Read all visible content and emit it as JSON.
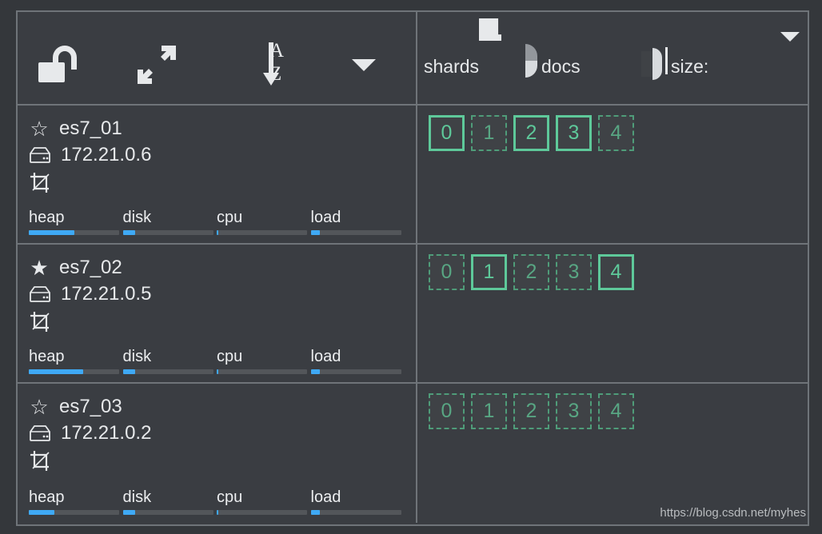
{
  "app": {
    "background_color": "#34373b",
    "panel_color": "#3a3d42",
    "border_color": "#6f7479",
    "accent_green": "#5ec99a",
    "accent_blue": "#3fa9f5",
    "text_color": "#e7e9eb"
  },
  "toolbar": {
    "unlock_icon": "unlock-icon",
    "expand_icon": "expand-arrows-icon",
    "sort_icon": "sort-alpha-down-icon",
    "sort_letters": {
      "first": "A",
      "second": "Z"
    },
    "filter_caret": "caret-down-icon",
    "collapse_caret": "caret-down-icon"
  },
  "summary": {
    "shards_label": "shards",
    "docs_label": "docs",
    "size_label": "size:",
    "shards_icon": "shards-square-icon",
    "docs_icon": "docs-half-circle-icon",
    "size_icon": "size-half-circle-icon"
  },
  "metric_labels": {
    "heap": "heap",
    "disk": "disk",
    "cpu": "cpu",
    "load": "load"
  },
  "nodes": [
    {
      "name": "es7_01",
      "ip": "172.21.0.6",
      "master": false,
      "star_icon": "star-outline-icon",
      "host_icon": "hdd-icon",
      "role_icon": "crop-icon",
      "metrics": {
        "heap": 50,
        "disk": 14,
        "cpu": 2,
        "load": 10
      },
      "shards": [
        {
          "id": "0",
          "type": "primary"
        },
        {
          "id": "1",
          "type": "replica"
        },
        {
          "id": "2",
          "type": "primary"
        },
        {
          "id": "3",
          "type": "primary"
        },
        {
          "id": "4",
          "type": "replica"
        }
      ]
    },
    {
      "name": "es7_02",
      "ip": "172.21.0.5",
      "master": true,
      "star_icon": "star-filled-icon",
      "host_icon": "hdd-icon",
      "role_icon": "crop-icon",
      "metrics": {
        "heap": 60,
        "disk": 14,
        "cpu": 2,
        "load": 10
      },
      "shards": [
        {
          "id": "0",
          "type": "replica"
        },
        {
          "id": "1",
          "type": "primary"
        },
        {
          "id": "2",
          "type": "replica"
        },
        {
          "id": "3",
          "type": "replica"
        },
        {
          "id": "4",
          "type": "primary"
        }
      ]
    },
    {
      "name": "es7_03",
      "ip": "172.21.0.2",
      "master": false,
      "star_icon": "star-outline-icon",
      "host_icon": "hdd-icon",
      "role_icon": "crop-icon",
      "metrics": {
        "heap": 28,
        "disk": 14,
        "cpu": 2,
        "load": 10
      },
      "shards": [
        {
          "id": "0",
          "type": "replica"
        },
        {
          "id": "1",
          "type": "replica"
        },
        {
          "id": "2",
          "type": "replica"
        },
        {
          "id": "3",
          "type": "replica"
        },
        {
          "id": "4",
          "type": "replica"
        }
      ]
    }
  ],
  "watermark": "https://blog.csdn.net/myhes"
}
